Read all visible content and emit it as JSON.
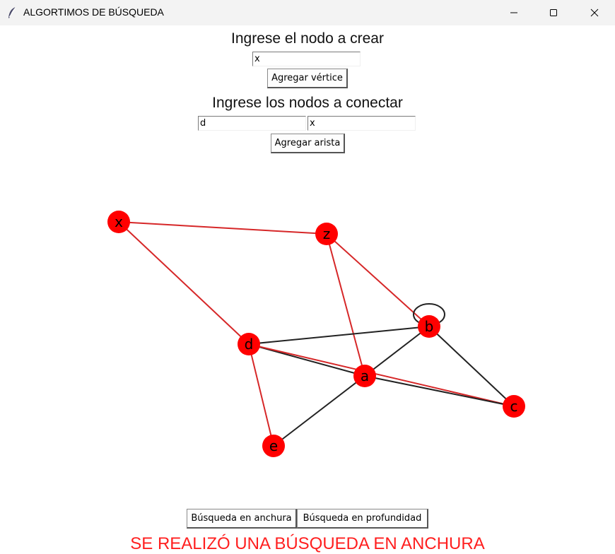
{
  "window": {
    "title": "ALGORTIMOS DE BÚSQUEDA",
    "controls": [
      "minimize",
      "maximize",
      "close"
    ]
  },
  "vertex_form": {
    "label": "Ingrese el nodo a crear",
    "value": "x",
    "button": "Agregar vértice"
  },
  "edge_form": {
    "label": "Ingrese los nodos a conectar",
    "from_value": "d",
    "to_value": "x",
    "button": "Agregar arista"
  },
  "graph": {
    "node_color": "#ff0000",
    "highlight_color": "#d62728",
    "edge_color": "#222222",
    "nodes": [
      "x",
      "z",
      "b",
      "d",
      "a",
      "c",
      "e"
    ],
    "edges": [
      {
        "from": "x",
        "to": "z",
        "highlighted": true
      },
      {
        "from": "x",
        "to": "d",
        "highlighted": true
      },
      {
        "from": "z",
        "to": "b",
        "highlighted": true
      },
      {
        "from": "z",
        "to": "a",
        "highlighted": true
      },
      {
        "from": "d",
        "to": "b",
        "highlighted": false
      },
      {
        "from": "d",
        "to": "a",
        "highlighted": false
      },
      {
        "from": "d",
        "to": "c",
        "highlighted": true
      },
      {
        "from": "d",
        "to": "e",
        "highlighted": true
      },
      {
        "from": "a",
        "to": "b",
        "highlighted": false
      },
      {
        "from": "a",
        "to": "c",
        "highlighted": false
      },
      {
        "from": "a",
        "to": "e",
        "highlighted": false
      },
      {
        "from": "b",
        "to": "c",
        "highlighted": false
      },
      {
        "from": "b",
        "to": "b",
        "highlighted": false
      }
    ]
  },
  "actions": {
    "bfs_button": "Búsqueda en anchura",
    "dfs_button": "Búsqueda en profundidad"
  },
  "status": {
    "message": "SE REALIZÓ UNA BÚSQUEDA EN ANCHURA",
    "color": "#ff1f1f"
  }
}
